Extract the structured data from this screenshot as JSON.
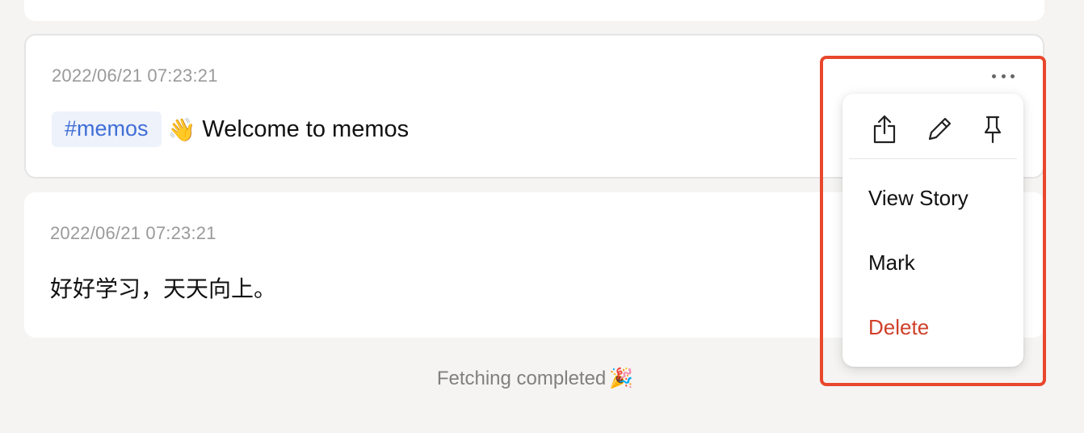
{
  "memos": [
    {
      "timestamp": "2022/06/21 07:23:21",
      "tag": "#memos",
      "emoji": "👋",
      "text": "Welcome to memos"
    },
    {
      "timestamp": "2022/06/21 07:23:21",
      "text": "好好学习，天天向上。"
    }
  ],
  "menu": {
    "icons": [
      "share-icon",
      "edit-icon",
      "pin-icon"
    ],
    "view_story": "View Story",
    "mark": "Mark",
    "delete": "Delete"
  },
  "footer": {
    "text": "Fetching completed",
    "emoji": "🎉"
  },
  "colors": {
    "background": "#f5f4f2",
    "card": "#ffffff",
    "tag_text": "#3f6fd6",
    "tag_bg": "#eef2fb",
    "delete": "#d0402b",
    "highlight": "#e8472d"
  }
}
